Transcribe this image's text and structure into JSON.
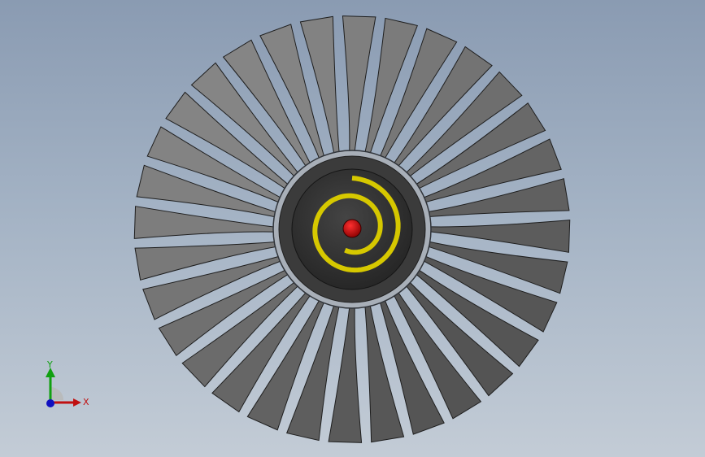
{
  "model": {
    "name": "fan-rotor",
    "blade_count": 32,
    "colors": {
      "background_top": "#8a9bb2",
      "background_bottom": "#c3ccd6",
      "blade_light": "#8e8e8e",
      "blade_dark": "#4a4a4a",
      "blade_edge": "#1e1e1e",
      "hub_ring": "#9aa0a8",
      "hub_face": "#3a3a3a",
      "hub_inner": "#2c2c2c",
      "spiral": "#d9cc00",
      "center_dot": "#c10000"
    }
  },
  "triad": {
    "x_label": "X",
    "y_label": "Y",
    "x_color": "#c01010",
    "y_color": "#10a010",
    "z_color": "#1010c0"
  }
}
